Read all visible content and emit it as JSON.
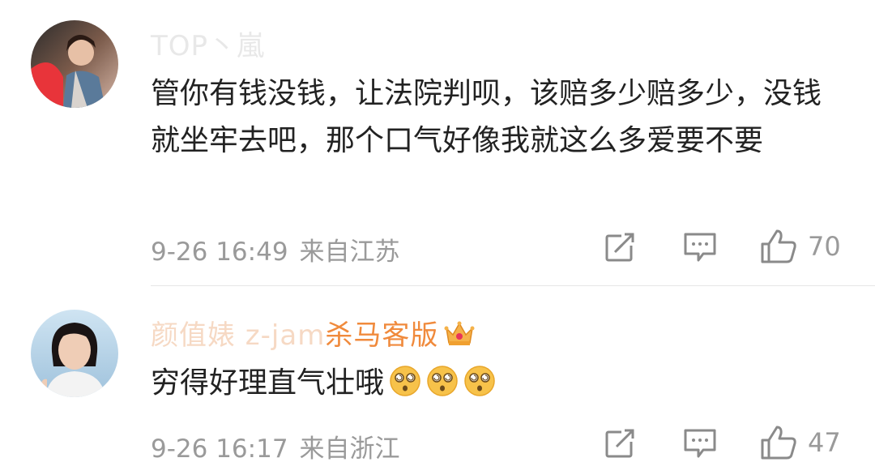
{
  "comments": [
    {
      "username": "TOP丶嵐",
      "text": "管你有钱没钱，让法院判呗，该赔多少赔多少，没钱就坐牢去吧，那个口气好像我就这么多爱要不要",
      "time": "9-26 16:49",
      "location": "来自江苏",
      "likes": "70",
      "avatar_icon": "photo-avatar"
    },
    {
      "username_faded": "颜值婊 z-jam",
      "username_strong": "杀马客版",
      "text": "穷得好理直气壮哦",
      "emojis": [
        "dizzy-face-icon",
        "dizzy-face-icon",
        "dizzy-face-icon"
      ],
      "time": "9-26 16:17",
      "location": "来自浙江",
      "likes": "47",
      "badge_icon": "crown-icon"
    }
  ],
  "colors": {
    "username_faded": "#f6d9c4",
    "username_strong": "#f08a3c",
    "text": "#222222",
    "meta": "#9a9a9a"
  }
}
